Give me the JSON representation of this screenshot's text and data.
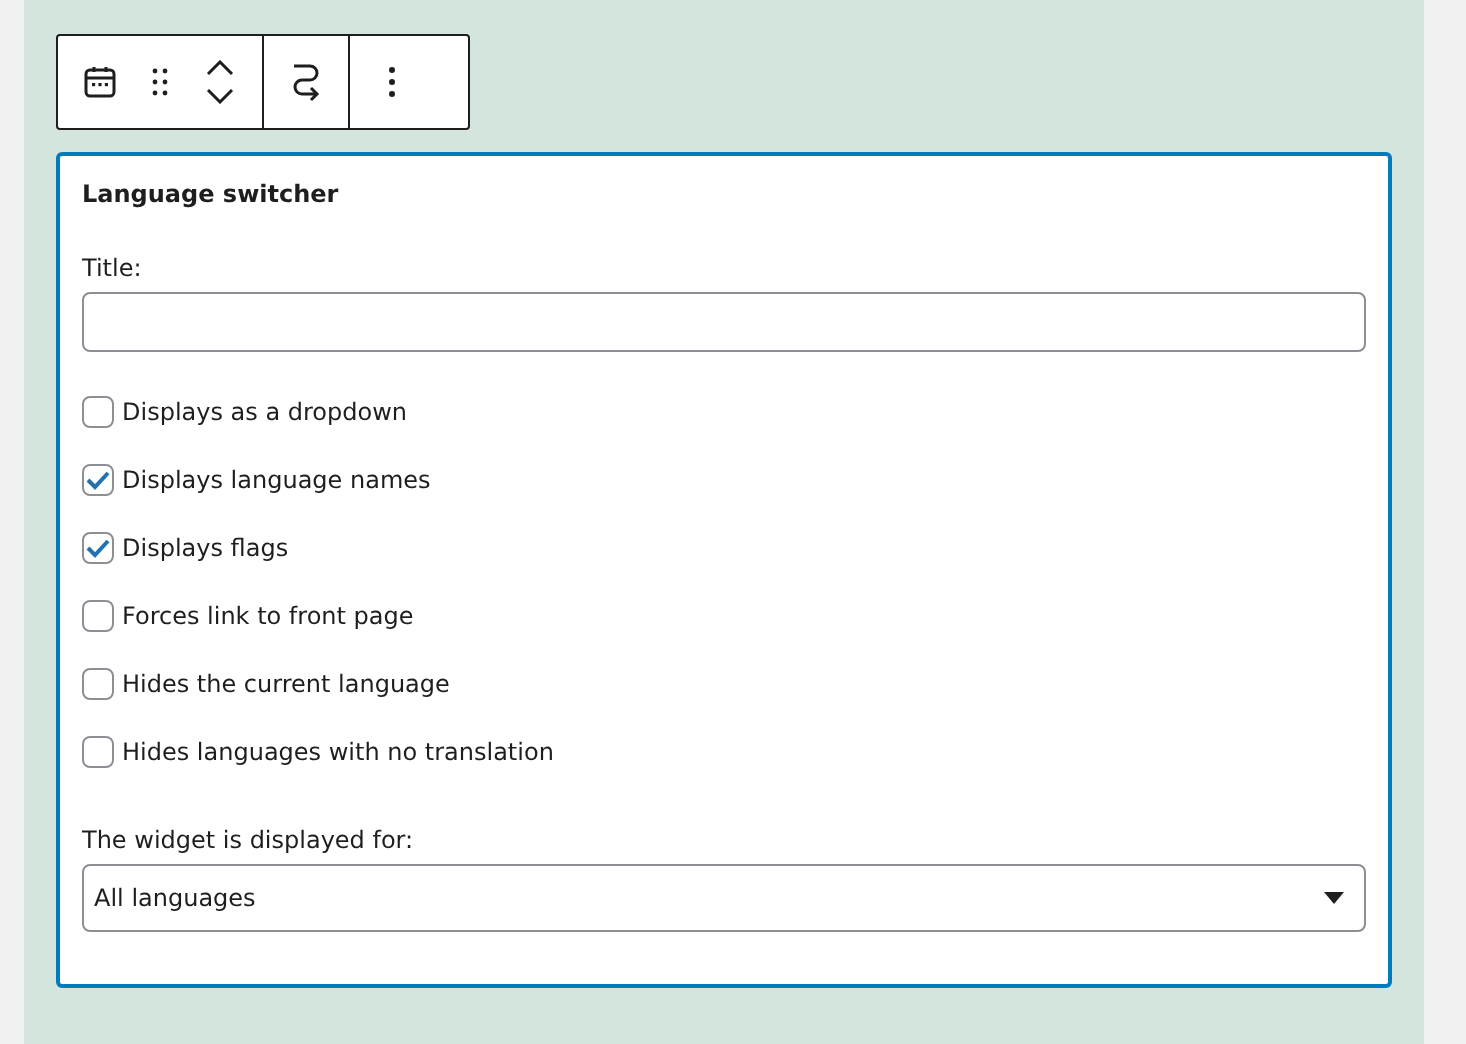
{
  "toolbar": {
    "buttons": [
      {
        "kind": "calendar"
      },
      {
        "kind": "drag"
      },
      {
        "kind": "move"
      },
      {
        "kind": "transform"
      },
      {
        "kind": "more"
      }
    ]
  },
  "widget": {
    "heading": "Language switcher",
    "title_label": "Title:",
    "options": [
      {
        "label": "Displays as a dropdown",
        "checked": false
      },
      {
        "label": "Displays language names",
        "checked": true
      },
      {
        "label": "Displays flags",
        "checked": true
      },
      {
        "label": "Forces link to front page",
        "checked": false
      },
      {
        "label": "Hides the current language",
        "checked": false
      },
      {
        "label": "Hides languages with no translation",
        "checked": false
      }
    ],
    "display_label": "The widget is displayed for:",
    "display_value": "All languages"
  }
}
